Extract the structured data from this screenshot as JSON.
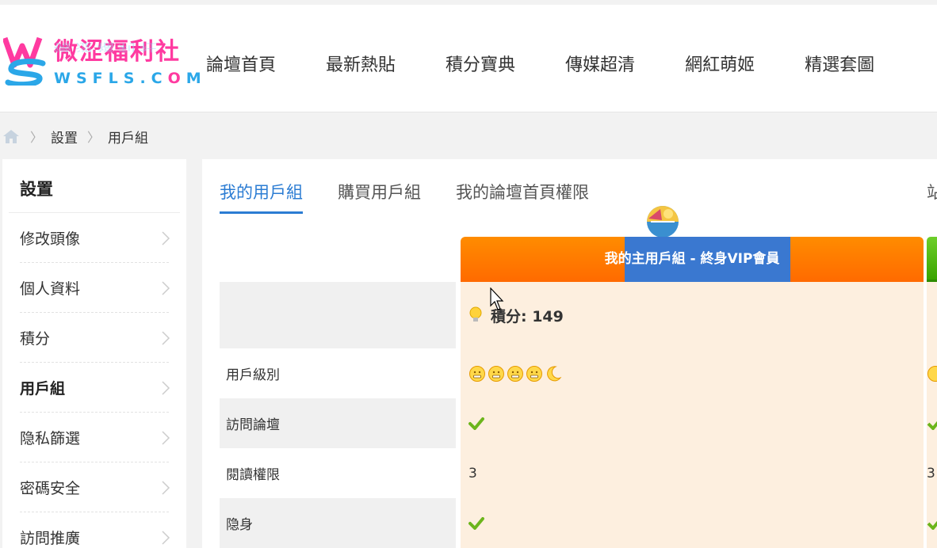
{
  "logo": {
    "chinese": "微涩福利社",
    "chinese_reflection": "微涩福利社",
    "domain_letters": [
      "W",
      "S",
      "F",
      "L",
      "S",
      ".",
      "C",
      "O",
      "M"
    ]
  },
  "nav": {
    "items": [
      "論壇首頁",
      "最新熱貼",
      "積分寶典",
      "傳媒超清",
      "網紅萌姬",
      "精選套圖"
    ]
  },
  "breadcrumb": {
    "home_icon": "home-icon",
    "items": [
      "設置",
      "用戶組"
    ]
  },
  "sidebar": {
    "title": "設置",
    "items": [
      {
        "label": "修改頭像",
        "active": false
      },
      {
        "label": "個人資料",
        "active": false
      },
      {
        "label": "積分",
        "active": false
      },
      {
        "label": "用戶組",
        "active": true
      },
      {
        "label": "隐私篩選",
        "active": false
      },
      {
        "label": "密碼安全",
        "active": false
      },
      {
        "label": "訪問推廣",
        "active": false
      }
    ]
  },
  "tabs": {
    "items": [
      "我的用戶組",
      "購買用戶組",
      "我的論壇首頁權限"
    ],
    "active_index": 0,
    "clipped_label": "站"
  },
  "group": {
    "header_prefix": "我的",
    "header_highlight": "主用戶組 - 終身VIP會員",
    "points_label": "積分: 149",
    "level_icons": [
      "sun-face-icon",
      "sun-face-icon",
      "sun-face-icon",
      "sun-face-icon",
      "moon-icon"
    ],
    "colors": {
      "header": "#ff7a00",
      "highlight": "#3a78d0",
      "cell": "#fdefdf",
      "second_group": "#4fb81a"
    }
  },
  "table": {
    "rows": [
      {
        "label": "",
        "value": "積分: 149",
        "type": "points"
      },
      {
        "label": "用戶級別",
        "value": "",
        "type": "icons"
      },
      {
        "label": "訪問論壇",
        "value": "✔",
        "type": "check"
      },
      {
        "label": "閱讀權限",
        "value": "3",
        "type": "text"
      },
      {
        "label": "隐身",
        "value": "✔",
        "type": "check"
      }
    ],
    "second_group_read_value": "3"
  }
}
